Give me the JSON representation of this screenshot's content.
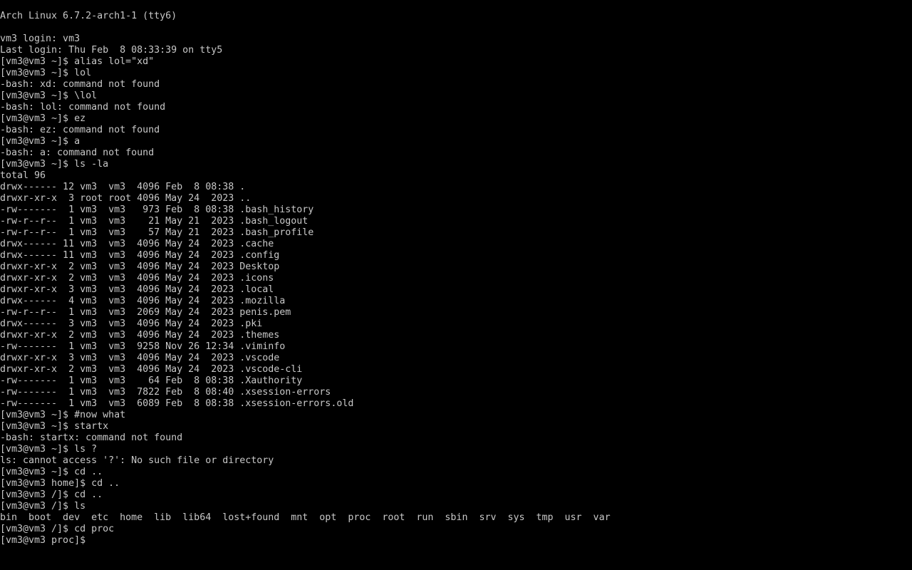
{
  "terminal": {
    "tty": "tty6",
    "lines": [
      "Arch Linux 6.7.2-arch1-1 (tty6)",
      "",
      "vm3 login: vm3",
      "Last login: Thu Feb  8 08:33:39 on tty5",
      "[vm3@vm3 ~]$ alias lol=\"xd\"",
      "[vm3@vm3 ~]$ lol",
      "-bash: xd: command not found",
      "[vm3@vm3 ~]$ \\lol",
      "-bash: lol: command not found",
      "[vm3@vm3 ~]$ ez",
      "-bash: ez: command not found",
      "[vm3@vm3 ~]$ a",
      "-bash: a: command not found",
      "[vm3@vm3 ~]$ ls -la",
      "total 96",
      "drwx------ 12 vm3  vm3  4096 Feb  8 08:38 .",
      "drwxr-xr-x  3 root root 4096 May 24  2023 ..",
      "-rw-------  1 vm3  vm3   973 Feb  8 08:38 .bash_history",
      "-rw-r--r--  1 vm3  vm3    21 May 21  2023 .bash_logout",
      "-rw-r--r--  1 vm3  vm3    57 May 21  2023 .bash_profile",
      "drwx------ 11 vm3  vm3  4096 May 24  2023 .cache",
      "drwx------ 11 vm3  vm3  4096 May 24  2023 .config",
      "drwxr-xr-x  2 vm3  vm3  4096 May 24  2023 Desktop",
      "drwxr-xr-x  2 vm3  vm3  4096 May 24  2023 .icons",
      "drwxr-xr-x  3 vm3  vm3  4096 May 24  2023 .local",
      "drwx------  4 vm3  vm3  4096 May 24  2023 .mozilla",
      "-rw-r--r--  1 vm3  vm3  2069 May 24  2023 penis.pem",
      "drwx------  3 vm3  vm3  4096 May 24  2023 .pki",
      "drwxr-xr-x  2 vm3  vm3  4096 May 24  2023 .themes",
      "-rw-------  1 vm3  vm3  9258 Nov 26 12:34 .viminfo",
      "drwxr-xr-x  3 vm3  vm3  4096 May 24  2023 .vscode",
      "drwxr-xr-x  2 vm3  vm3  4096 May 24  2023 .vscode-cli",
      "-rw-------  1 vm3  vm3    64 Feb  8 08:38 .Xauthority",
      "-rw-------  1 vm3  vm3  7822 Feb  8 08:40 .xsession-errors",
      "-rw-------  1 vm3  vm3  6089 Feb  8 08:38 .xsession-errors.old",
      "[vm3@vm3 ~]$ #now what",
      "[vm3@vm3 ~]$ startx",
      "-bash: startx: command not found",
      "[vm3@vm3 ~]$ ls ?",
      "ls: cannot access '?': No such file or directory",
      "[vm3@vm3 ~]$ cd ..",
      "[vm3@vm3 home]$ cd ..",
      "[vm3@vm3 /]$ cd ..",
      "[vm3@vm3 /]$ ls",
      "bin  boot  dev  etc  home  lib  lib64  lost+found  mnt  opt  proc  root  run  sbin  srv  sys  tmp  usr  var",
      "[vm3@vm3 /]$ cd proc",
      "[vm3@vm3 proc]$ "
    ]
  },
  "colors": {
    "background": "#000000",
    "foreground": "#c8c8c8"
  }
}
